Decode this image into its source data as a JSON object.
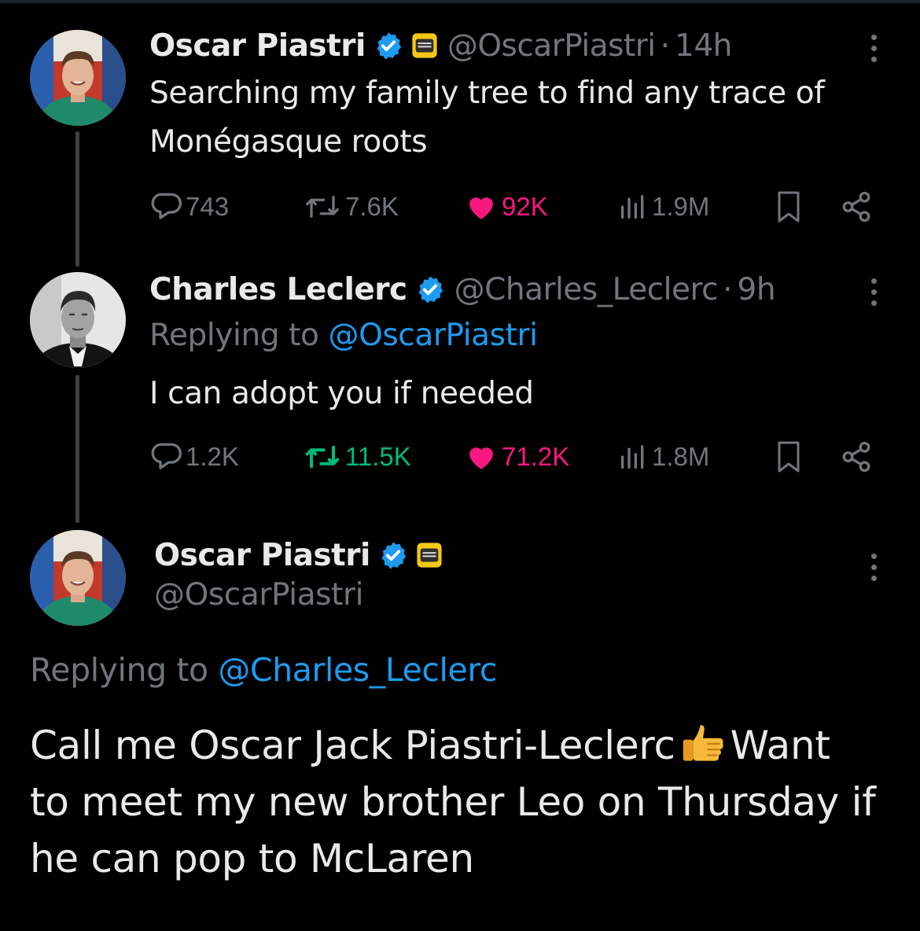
{
  "tweet1": {
    "name": "Oscar Piastri",
    "handle": "@OscarPiastri",
    "time": "14h",
    "text_line1": "Searching my family tree to find any trace of",
    "text_line2": "Monégasque roots",
    "replies": "743",
    "retweets": "7.6K",
    "likes": "92K",
    "views": "1.9M",
    "icons": [
      "verified-badge-icon",
      "mclaren-affiliate-icon",
      "more-icon",
      "reply-icon",
      "retweet-icon",
      "like-icon",
      "views-icon",
      "bookmark-icon",
      "share-icon"
    ]
  },
  "tweet2": {
    "name": "Charles Leclerc",
    "handle": "@Charles_Leclerc",
    "time": "9h",
    "replying_label": "Replying to",
    "replying_to": "@OscarPiastri",
    "text": "I can adopt you if needed",
    "replies": "1.2K",
    "retweets": "11.5K",
    "likes": "71.2K",
    "views": "1.8M"
  },
  "main_tweet": {
    "name": "Oscar Piastri",
    "handle": "@OscarPiastri",
    "replying_label": "Replying to",
    "replying_to": "@Charles_Leclerc",
    "text_line1_a": "Call me Oscar Jack Piastri-Leclerc",
    "text_line1_b": "Want",
    "text_line2": "to meet my new brother Leo on Thursday if",
    "text_line3": "he can pop to McLaren"
  },
  "colors": {
    "background": "#000000",
    "text": "#e7e9ea",
    "muted": "#71767b",
    "link": "#1d9bf0",
    "like": "#f91880",
    "retweet": "#00ba7c"
  }
}
